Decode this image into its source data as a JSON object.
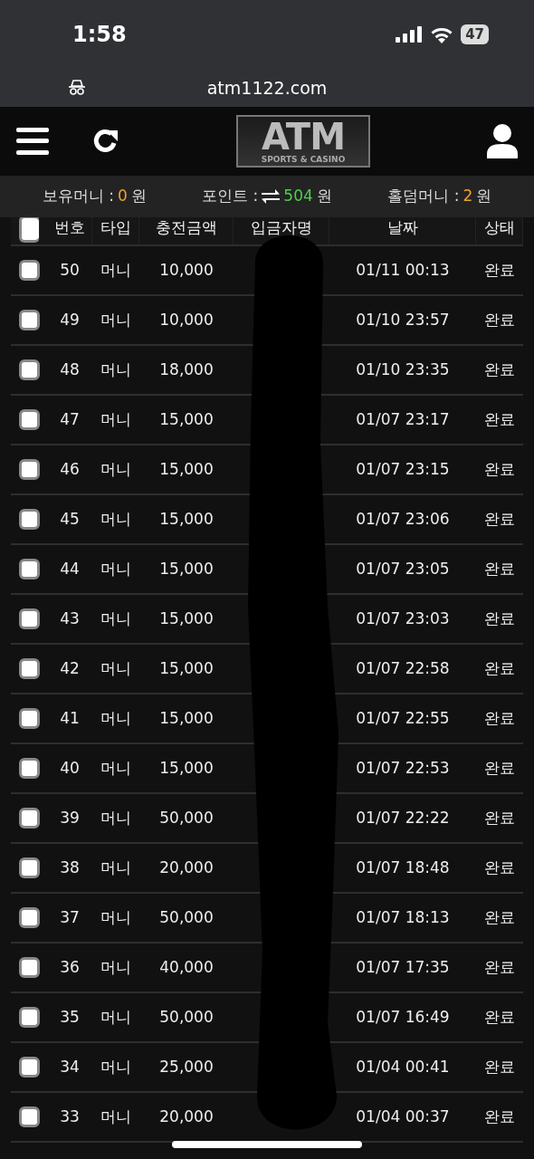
{
  "status_bar": {
    "time": "1:58",
    "battery": "47"
  },
  "browser": {
    "url": "atm1122.com"
  },
  "header": {
    "logo_title": "ATM",
    "logo_subtitle": "SPORTS & CASINO"
  },
  "balances": [
    {
      "label": "보유머니 :",
      "value": "0",
      "unit": "원",
      "color": "#f0a030",
      "kind": "plain"
    },
    {
      "label": "포인트 :",
      "value": "504",
      "unit": "원",
      "color": "#4cd04c",
      "kind": "exchange"
    },
    {
      "label": "홀덤머니 :",
      "value": "2",
      "unit": "원",
      "color": "#f0a030",
      "kind": "plain"
    }
  ],
  "table": {
    "header_checked": false,
    "columns": [
      "번호",
      "타입",
      "충전금액",
      "입금자명",
      "날짜",
      "상태"
    ],
    "rows": [
      {
        "checked": false,
        "number": "50",
        "type": "머니",
        "amount": "10,000",
        "date": "01/11 00:13",
        "status": "완료"
      },
      {
        "checked": false,
        "number": "49",
        "type": "머니",
        "amount": "10,000",
        "date": "01/10 23:57",
        "status": "완료"
      },
      {
        "checked": false,
        "number": "48",
        "type": "머니",
        "amount": "18,000",
        "date": "01/10 23:35",
        "status": "완료"
      },
      {
        "checked": false,
        "number": "47",
        "type": "머니",
        "amount": "15,000",
        "date": "01/07 23:17",
        "status": "완료"
      },
      {
        "checked": false,
        "number": "46",
        "type": "머니",
        "amount": "15,000",
        "date": "01/07 23:15",
        "status": "완료"
      },
      {
        "checked": false,
        "number": "45",
        "type": "머니",
        "amount": "15,000",
        "date": "01/07 23:06",
        "status": "완료"
      },
      {
        "checked": false,
        "number": "44",
        "type": "머니",
        "amount": "15,000",
        "date": "01/07 23:05",
        "status": "완료"
      },
      {
        "checked": false,
        "number": "43",
        "type": "머니",
        "amount": "15,000",
        "date": "01/07 23:03",
        "status": "완료"
      },
      {
        "checked": false,
        "number": "42",
        "type": "머니",
        "amount": "15,000",
        "date": "01/07 22:58",
        "status": "완료"
      },
      {
        "checked": false,
        "number": "41",
        "type": "머니",
        "amount": "15,000",
        "date": "01/07 22:55",
        "status": "완료"
      },
      {
        "checked": false,
        "number": "40",
        "type": "머니",
        "amount": "15,000",
        "date": "01/07 22:53",
        "status": "완료"
      },
      {
        "checked": false,
        "number": "39",
        "type": "머니",
        "amount": "50,000",
        "date": "01/07 22:22",
        "status": "완료"
      },
      {
        "checked": false,
        "number": "38",
        "type": "머니",
        "amount": "20,000",
        "date": "01/07 18:48",
        "status": "완료"
      },
      {
        "checked": false,
        "number": "37",
        "type": "머니",
        "amount": "50,000",
        "date": "01/07 18:13",
        "status": "완료"
      },
      {
        "checked": false,
        "number": "36",
        "type": "머니",
        "amount": "40,000",
        "date": "01/07 17:35",
        "status": "완료"
      },
      {
        "checked": false,
        "number": "35",
        "type": "머니",
        "amount": "50,000",
        "date": "01/07 16:49",
        "status": "완료"
      },
      {
        "checked": false,
        "number": "34",
        "type": "머니",
        "amount": "25,000",
        "date": "01/04 00:41",
        "status": "완료"
      },
      {
        "checked": false,
        "number": "33",
        "type": "머니",
        "amount": "20,000",
        "date": "01/04 00:37",
        "status": "완료"
      }
    ]
  }
}
